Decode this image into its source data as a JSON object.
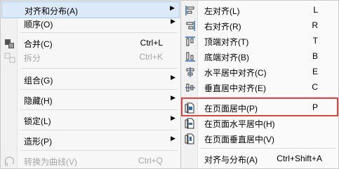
{
  "main_menu": {
    "items": [
      {
        "label": "对齐和分布(A)",
        "shortcut": "",
        "submenu": true,
        "disabled": false
      },
      {
        "label": "顺序(O)",
        "shortcut": "",
        "submenu": true,
        "disabled": false
      },
      {
        "label": "合并(C)",
        "shortcut": "Ctrl+L",
        "submenu": false,
        "disabled": false
      },
      {
        "label": "拆分",
        "shortcut": "Ctrl+K",
        "submenu": false,
        "disabled": true
      },
      {
        "label": "组合(G)",
        "shortcut": "",
        "submenu": true,
        "disabled": false
      },
      {
        "label": "隐藏(H)",
        "shortcut": "",
        "submenu": true,
        "disabled": false
      },
      {
        "label": "锁定(L)",
        "shortcut": "",
        "submenu": true,
        "disabled": false
      },
      {
        "label": "造形(P)",
        "shortcut": "",
        "submenu": true,
        "disabled": false
      },
      {
        "label": "转换为曲线(V)",
        "shortcut": "Ctrl+Q",
        "submenu": false,
        "disabled": true
      }
    ]
  },
  "sub_menu": {
    "items": [
      {
        "label": "左对齐(L)",
        "shortcut": "L"
      },
      {
        "label": "右对齐(R)",
        "shortcut": "R"
      },
      {
        "label": "顶端对齐(T)",
        "shortcut": "T"
      },
      {
        "label": "底端对齐(B)",
        "shortcut": "B"
      },
      {
        "label": "水平居中对齐(C)",
        "shortcut": "E"
      },
      {
        "label": "垂直居中对齐(E)",
        "shortcut": "C"
      },
      {
        "label": "在页面居中(P)",
        "shortcut": "P"
      },
      {
        "label": "在页面水平居中(H)",
        "shortcut": ""
      },
      {
        "label": "在页面垂直居中(V)",
        "shortcut": ""
      },
      {
        "label": "对齐与分布(A)",
        "shortcut": "Ctrl+Shift+A"
      }
    ]
  },
  "submenu_arrow": "▶",
  "colors": {
    "highlight_bg": "#dbe9f8",
    "highlight_border": "#a8c8ef",
    "annotation_box": "#d94646",
    "disabled_text": "#a7a7a7",
    "icon_blue": "#2f6fb0"
  }
}
